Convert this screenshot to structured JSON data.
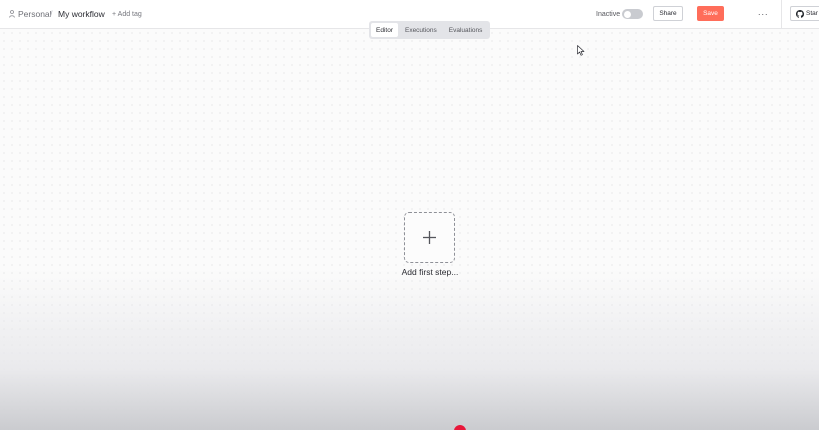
{
  "header": {
    "project": "Personal",
    "separator": "/",
    "workflow_name": "My workflow",
    "add_tag": "+ Add tag",
    "status_label": "Inactive",
    "active": false,
    "share_label": "Share",
    "save_label": "Save",
    "more_label": "···",
    "github_label": "Star"
  },
  "tabs": [
    {
      "label": "Editor",
      "active": true
    },
    {
      "label": "Executions",
      "active": false
    },
    {
      "label": "Evaluations",
      "active": false
    }
  ],
  "canvas": {
    "add_first_step": "Add first step..."
  },
  "colors": {
    "accent": "#ff6d5a",
    "record_dot": "#e8173a"
  },
  "icons": {
    "project": "person-icon",
    "add_step": "plus-icon",
    "github": "github-icon",
    "cursor": "mouse-pointer-icon"
  }
}
